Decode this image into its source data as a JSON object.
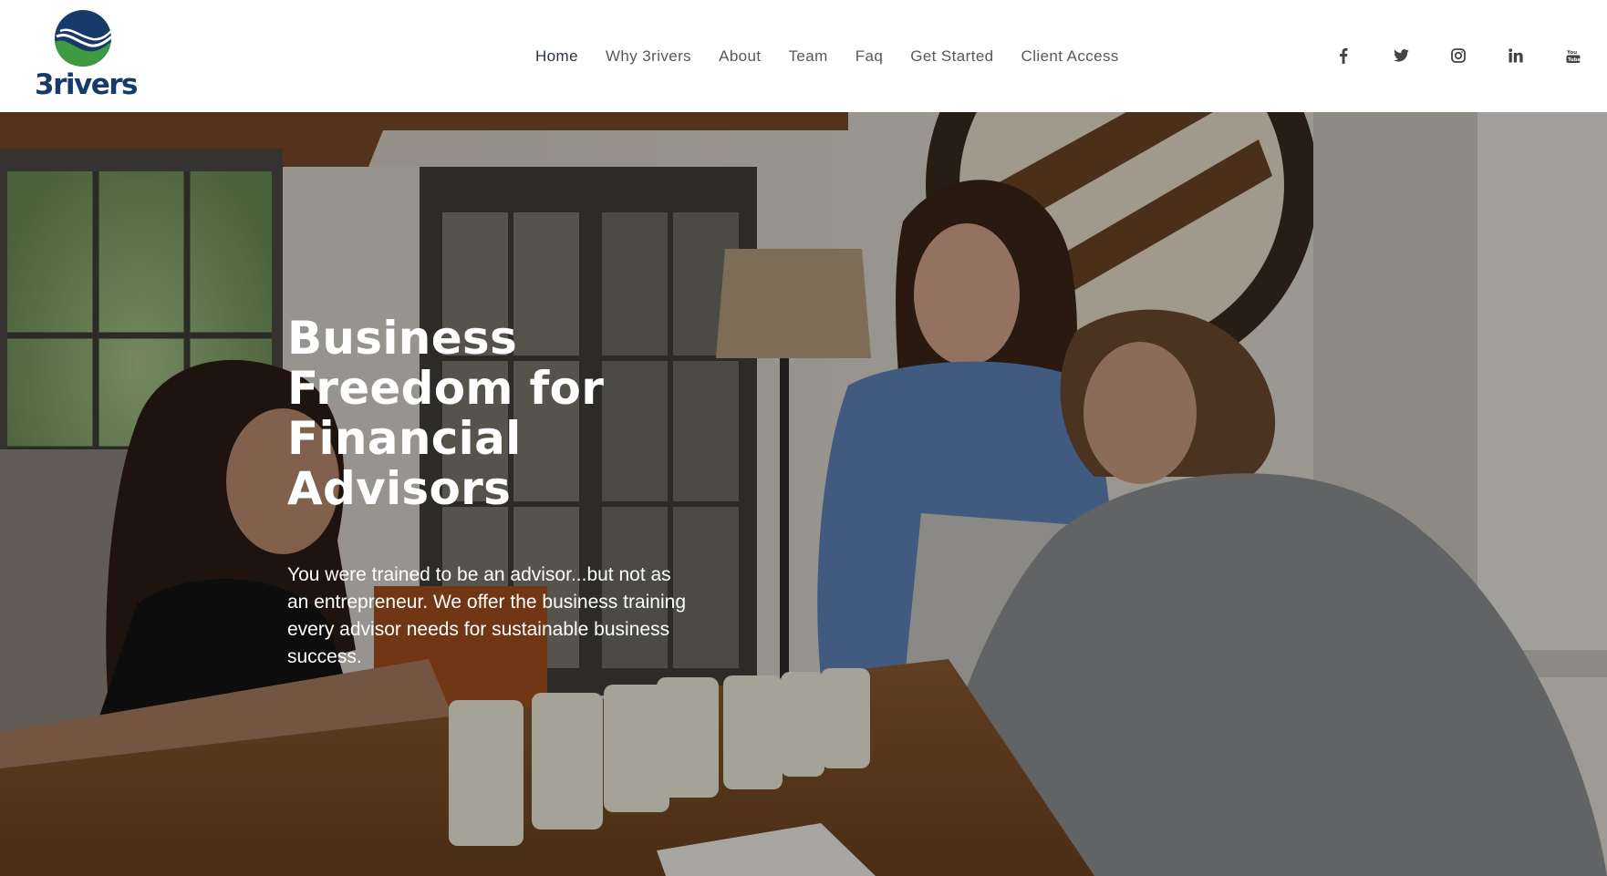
{
  "brand": {
    "name": "3rivers",
    "colors": {
      "navy": "#173a6b",
      "green": "#3f9a44"
    }
  },
  "nav": {
    "items": [
      {
        "label": "Home",
        "active": true
      },
      {
        "label": "Why 3rivers",
        "active": false
      },
      {
        "label": "About",
        "active": false
      },
      {
        "label": "Team",
        "active": false
      },
      {
        "label": "Faq",
        "active": false
      },
      {
        "label": "Get Started",
        "active": false
      },
      {
        "label": "Client Access",
        "active": false
      }
    ]
  },
  "social": {
    "icons": [
      "facebook-icon",
      "twitter-icon",
      "instagram-icon",
      "linkedin-icon",
      "youtube-icon"
    ],
    "color": "#444444"
  },
  "hero": {
    "title": "Business Freedom for Financial Advisors",
    "text": "You were trained to be an advisor...but not as an entrepreneur. We offer the business training every advisor needs for sustainable business success."
  }
}
